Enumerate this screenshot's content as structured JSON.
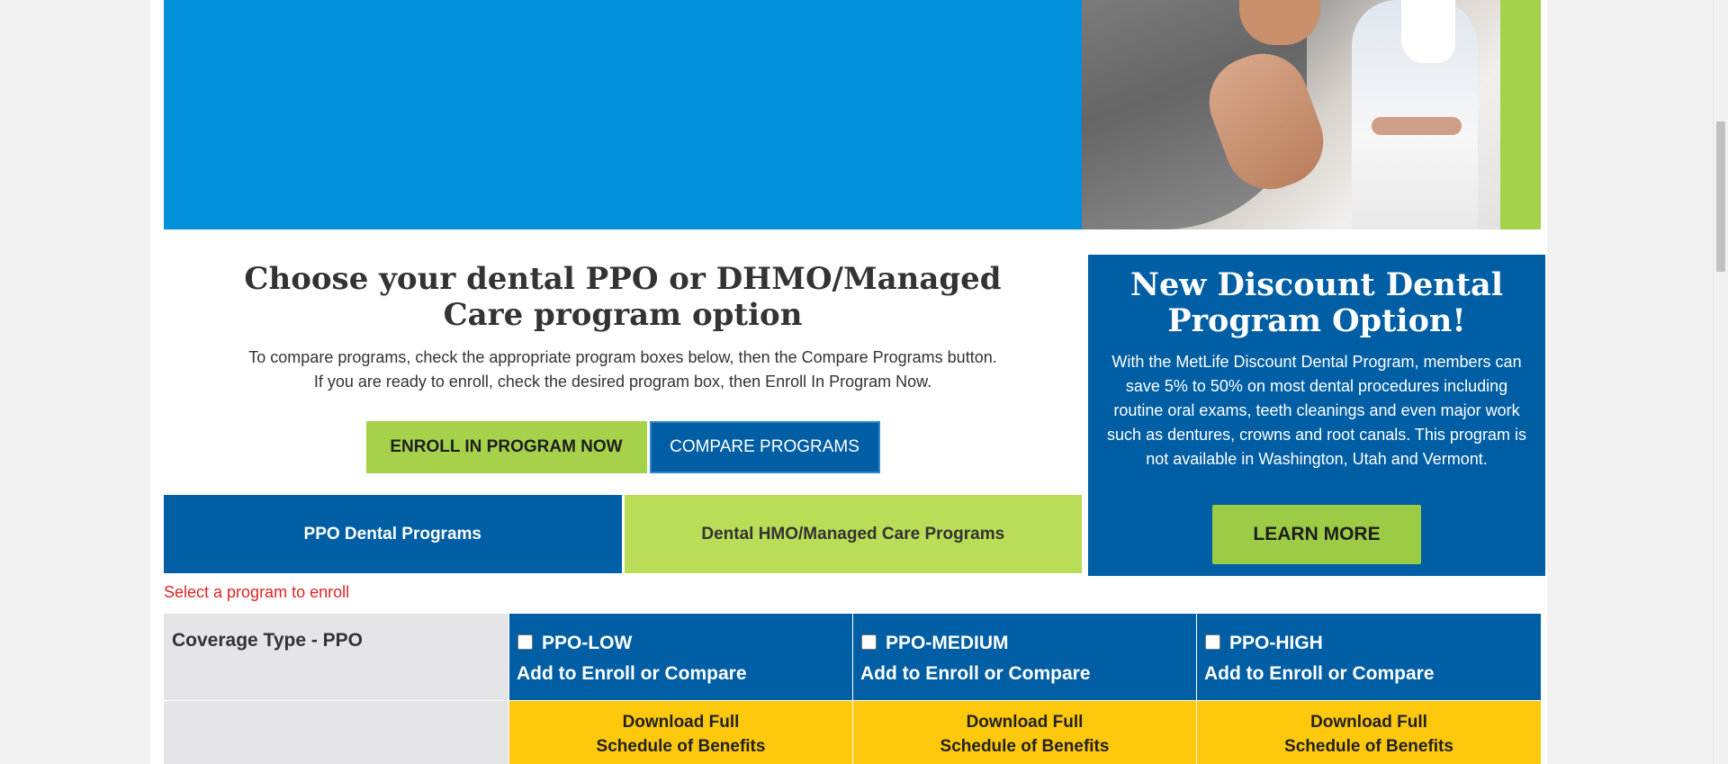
{
  "intro": {
    "title": "Choose your dental PPO or DHMO/Managed Care program option",
    "line1": "To compare programs, check the appropriate program boxes below, then the Compare Programs button.",
    "line2": "If you are ready to enroll, check the desired program box, then Enroll In Program Now."
  },
  "buttons": {
    "enroll": "ENROLL IN PROGRAM NOW",
    "compare": "COMPARE PROGRAMS"
  },
  "tabs": [
    "PPO Dental Programs",
    "Dental HMO/Managed Care Programs"
  ],
  "discount": {
    "title": "New Discount Dental Program Option!",
    "body": "With the MetLife Discount Dental Program, members can save 5% to 50% on most dental procedures including routine oral exams, teeth cleanings and even major work such as dentures, crowns and root canals. This program is not available in Washington, Utah and Vermont.",
    "button": "LEARN MORE"
  },
  "select_message": "Select a program to enroll",
  "table": {
    "row_label": "Coverage Type - PPO",
    "plans": [
      {
        "name": "PPO-LOW",
        "action": "Add to Enroll or Compare",
        "download1": "Download Full",
        "download2": "Schedule of Benefits"
      },
      {
        "name": "PPO-MEDIUM",
        "action": "Add to Enroll or Compare",
        "download1": "Download Full",
        "download2": "Schedule of Benefits"
      },
      {
        "name": "PPO-HIGH",
        "action": "Add to Enroll or Compare",
        "download1": "Download Full",
        "download2": "Schedule of Benefits"
      }
    ]
  },
  "colors": {
    "hero_blue": "#0290d9",
    "brand_blue": "#005ea4",
    "brand_green": "#a5d24a",
    "download_yellow": "#fec80c",
    "error_red": "#e32323"
  }
}
